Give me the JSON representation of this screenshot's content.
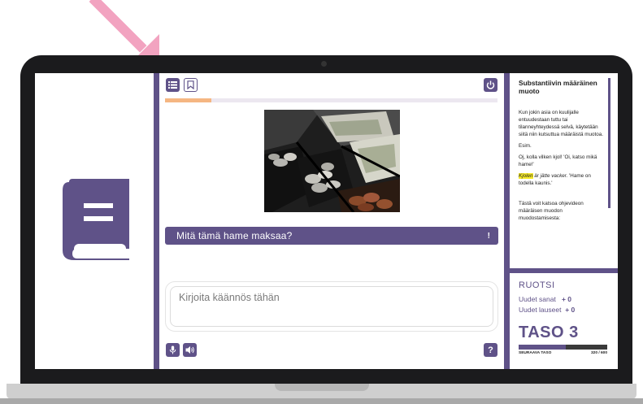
{
  "colors": {
    "accent": "#5f5288",
    "progress": "#f5b682",
    "arrow": "#f2a3c0",
    "highlight": "#f6ea2a"
  },
  "toolbar": {
    "list_icon": "list-icon",
    "bookmark_icon": "bookmark-icon",
    "power_icon": "power-icon"
  },
  "progress": {
    "fraction": 0.14
  },
  "exercise": {
    "image": "cash-register-drawer-photo",
    "question": "Mitä tämä hame maksaa?",
    "question_hint": "!",
    "answer_placeholder": "Kirjoita käännös tähän",
    "mic_icon": "microphone-icon",
    "speaker_icon": "speaker-icon",
    "help_label": "?"
  },
  "tip": {
    "title": "Substantiivin määräinen muoto",
    "p1": "Kun jokin asia on kuulijalle entuudestaan tuttu tai tilanneyhteydessä selvä, käytetään siitä niin kutsuttua määräistä muotoa.",
    "p2": "Esim.",
    "p3": "Oj, kolla vilken kjol! 'Oi, katso mikä hame!'",
    "p4_highlight": "Kjolen",
    "p4_rest": " är jätte vacker.",
    "p4_translation": " 'Hame on todella kaunis.'",
    "p5": "Tästä voit katsoa ohjevideon määräisen muodon muodostamisesta:"
  },
  "stats": {
    "language": "RUOTSI",
    "new_words_label": "Uudet sanat",
    "new_words_value": "+ 0",
    "new_sentences_label": "Uudet lauseet",
    "new_sentences_value": "+ 0",
    "level": "TASO 3",
    "next_level_label": "SEURAAVA TASO",
    "next_level_progress": "320 / 600",
    "next_level_fraction": 0.533
  },
  "left_pane": {
    "icon": "book-icon"
  }
}
